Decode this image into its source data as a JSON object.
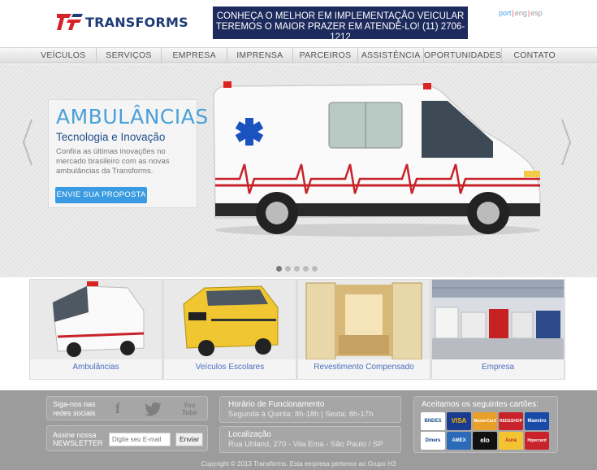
{
  "header": {
    "logo_text": "TRANSFORMS",
    "banner_line1": "CONHEÇA O MELHOR EM IMPLEMENTAÇÃO VEICULAR",
    "banner_line2": "TEREMOS O MAIOR PRAZER EM ATENDÊ-LO! (11) 2706-1212",
    "languages": [
      "port",
      "eng",
      "esp"
    ],
    "active_language": "port"
  },
  "nav": {
    "items": [
      "VEÍCULOS",
      "SERVIÇOS",
      "EMPRESA",
      "IMPRENSA",
      "PARCEIROS",
      "ASSISTÊNCIA",
      "OPORTUNIDADES",
      "CONTATO"
    ]
  },
  "hero": {
    "title": "AMBULÂNCIAS",
    "subtitle": "Tecnologia e Inovação",
    "description": "Confira as últimas inovações no mercado brasileiro com as novas ambulâncias da Transforms.",
    "button_label": "ENVIE SUA PROPOSTA",
    "slide_count": 5,
    "active_slide": 1,
    "accent_color": "#3a9be2"
  },
  "thumbnails": [
    {
      "label": "Ambulâncias"
    },
    {
      "label": "Veículos Escolares"
    },
    {
      "label": "Revestimento Compensado"
    },
    {
      "label": "Empresa"
    }
  ],
  "footer": {
    "social_label": "Siga-nos nas redes sociais",
    "social_icons": [
      "facebook-icon",
      "twitter-icon",
      "youtube-icon"
    ],
    "youtube_text": "You Tube",
    "newsletter_label": "Assine nossa NEWSLETTER",
    "newsletter_placeholder": "Digite seu E-mail",
    "newsletter_button": "Enviar",
    "hours_title": "Horário de Funcionamento",
    "hours_text": "Segunda à Quinta: 8h-18h  |  Sexta: 8h-17h",
    "location_title": "Localização",
    "location_text": "Rua Uhland, 270 - Vila Ema - São Paulo / SP",
    "cards_title": "Aceitamos os seguintes cartões:",
    "cards": [
      "BNDES",
      "VISA",
      "MasterCard",
      "REDESHOP",
      "Maestro",
      "Diners",
      "AMEX",
      "elo",
      "Aura",
      "Hipercard"
    ],
    "copyright": "Copyright © 2013 Transforms. Esta empresa pertence ao Grupo H3"
  }
}
